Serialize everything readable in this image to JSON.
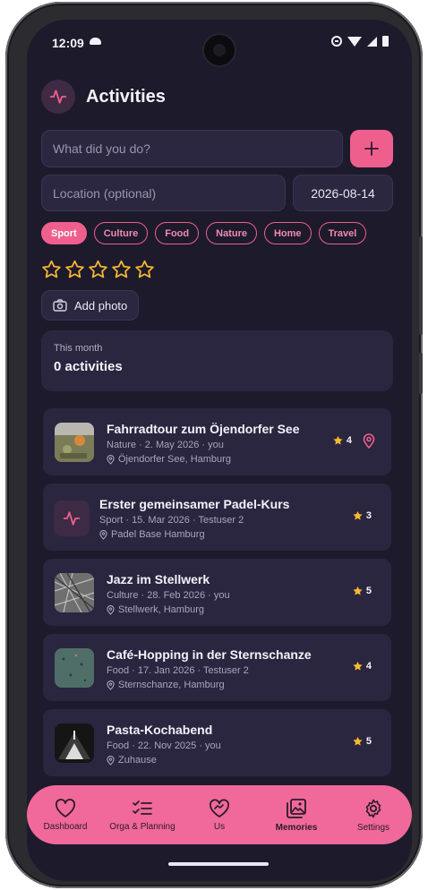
{
  "status_bar": {
    "time": "12:09"
  },
  "header": {
    "title": "Activities"
  },
  "form": {
    "what_placeholder": "What did you do?",
    "location_placeholder": "Location (optional)",
    "date_value": "2026-08-14",
    "add_label": "+",
    "categories": [
      "Sport",
      "Culture",
      "Food",
      "Nature",
      "Home",
      "Travel"
    ],
    "selected_category": "Sport",
    "rating": 0,
    "max_rating": 5,
    "add_photo_label": "Add photo"
  },
  "summary": {
    "label": "This month",
    "value": "0 activities"
  },
  "activities": [
    {
      "title": "Fahrradtour zum Öjendorfer See",
      "meta": "Nature · 2. May 2026 · you",
      "location": "Öjendorfer See, Hamburg",
      "rating": "4",
      "thumb": "photo-field"
    },
    {
      "title": "Erster gemeinsamer Padel-Kurs",
      "meta": "Sport · 15. Mar 2026 · Testuser 2",
      "location": "Padel Base Hamburg",
      "rating": "3",
      "thumb": "activity-icon"
    },
    {
      "title": "Jazz im Stellwerk",
      "meta": "Culture · 28. Feb 2026 · you",
      "location": "Stellwerk, Hamburg",
      "rating": "5",
      "thumb": "photo-bw"
    },
    {
      "title": "Café-Hopping in der Sternschanze",
      "meta": "Food · 17. Jan 2026 · Testuser 2",
      "location": "Sternschanze, Hamburg",
      "rating": "4",
      "thumb": "photo-teal"
    },
    {
      "title": "Pasta-Kochabend",
      "meta": "Food · 22. Nov 2025 · you",
      "location": "Zuhause",
      "rating": "5",
      "thumb": "photo-dark"
    }
  ],
  "nav": [
    {
      "label": "Dashboard",
      "icon": "heart-icon"
    },
    {
      "label": "Orga & Planning",
      "icon": "checklist-icon"
    },
    {
      "label": "Us",
      "icon": "handshake-heart-icon"
    },
    {
      "label": "Memories",
      "icon": "gallery-icon",
      "active": true
    },
    {
      "label": "Settings",
      "icon": "gear-icon"
    }
  ],
  "colors": {
    "accent": "#ef5f8e",
    "background": "#1d1a2c",
    "card": "#2a2640",
    "star": "#f5b731"
  }
}
